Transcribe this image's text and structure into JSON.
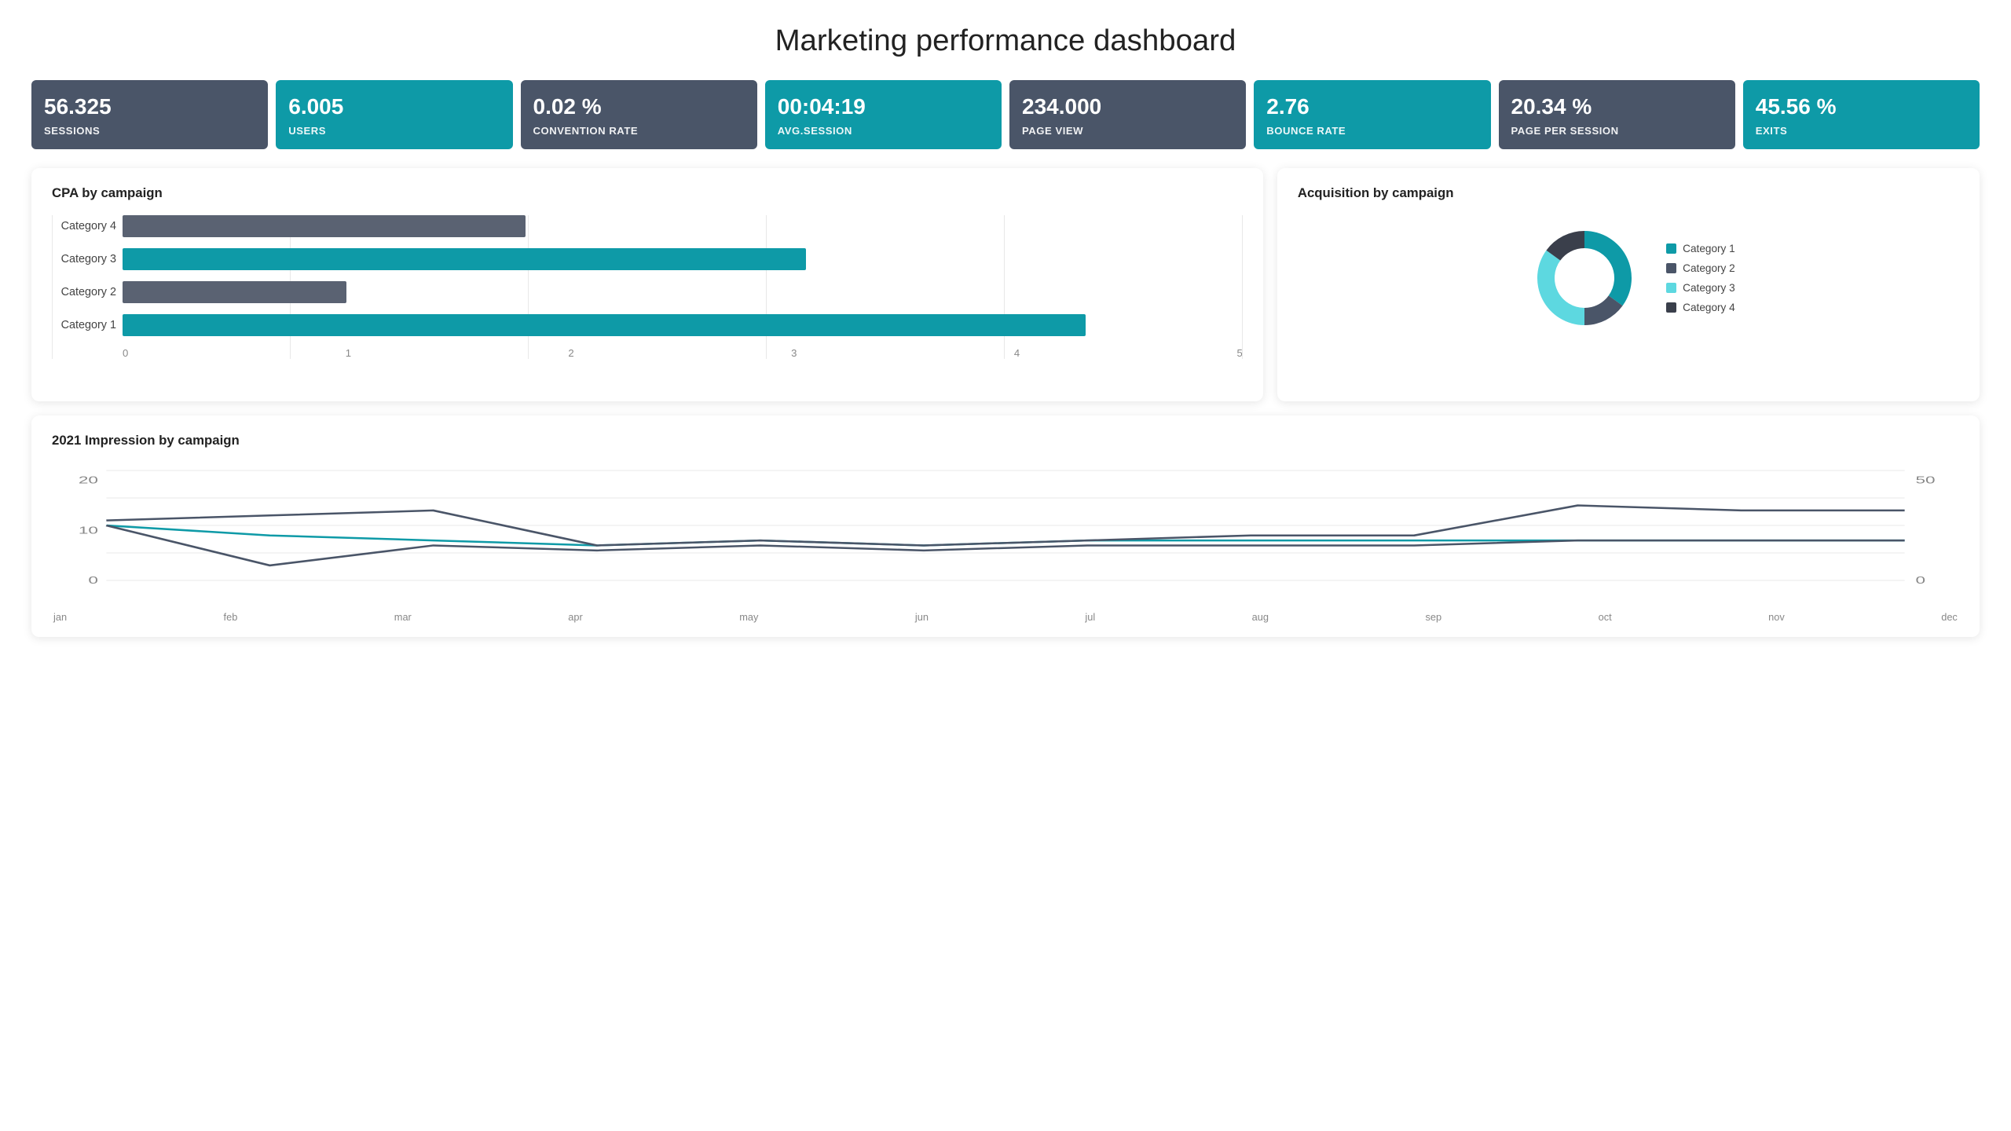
{
  "page": {
    "title": "Marketing performance dashboard"
  },
  "kpis": [
    {
      "id": "sessions",
      "value": "56.325",
      "label": "Sessions",
      "style": "dark"
    },
    {
      "id": "users",
      "value": "6.005",
      "label": "Users",
      "style": "teal"
    },
    {
      "id": "convention-rate",
      "value": "0.02 %",
      "label": "Convention Rate",
      "style": "dark"
    },
    {
      "id": "avg-session",
      "value": "00:04:19",
      "label": "Avg.Session",
      "style": "teal"
    },
    {
      "id": "page-view",
      "value": "234.000",
      "label": "Page View",
      "style": "dark"
    },
    {
      "id": "bounce-rate",
      "value": "2.76",
      "label": "Bounce Rate",
      "style": "teal"
    },
    {
      "id": "page-per-session",
      "value": "20.34 %",
      "label": "Page per Session",
      "style": "dark"
    },
    {
      "id": "exits",
      "value": "45.56 %",
      "label": "Exits",
      "style": "teal"
    }
  ],
  "cpa_chart": {
    "title": "CPA by campaign",
    "bars": [
      {
        "label": "Category 4",
        "value": 1.8,
        "color": "gray"
      },
      {
        "label": "Category 3",
        "value": 3.05,
        "color": "teal"
      },
      {
        "label": "Category 2",
        "value": 1.0,
        "color": "gray"
      },
      {
        "label": "Category 1",
        "value": 4.3,
        "color": "teal"
      }
    ],
    "x_ticks": [
      "0",
      "1",
      "2",
      "3",
      "4",
      "5"
    ],
    "max": 5
  },
  "acquisition_chart": {
    "title": "Acquisition by campaign",
    "segments": [
      {
        "label": "Category 1",
        "color": "#0e9aa7",
        "percent": 35
      },
      {
        "label": "Category 2",
        "color": "#4a5568",
        "percent": 15
      },
      {
        "label": "Category 3",
        "color": "#5dd8e0",
        "percent": 35
      },
      {
        "label": "Category 4",
        "color": "#3a3f4b",
        "percent": 15
      }
    ]
  },
  "impression_chart": {
    "title": "2021 Impression by campaign",
    "months": [
      "jan",
      "feb",
      "mar",
      "apr",
      "may",
      "jun",
      "jul",
      "aug",
      "sep",
      "oct",
      "nov",
      "dec"
    ],
    "y_left_ticks": [
      "0",
      "10",
      "20"
    ],
    "y_right_ticks": [
      "0",
      "50"
    ],
    "series": [
      {
        "name": "Category 1",
        "color": "#0e9aa7",
        "values": [
          11,
          9,
          8,
          7,
          8,
          7,
          8,
          8,
          8,
          8,
          8,
          8
        ]
      },
      {
        "name": "Category 2",
        "color": "#4a5568",
        "values": [
          12,
          13,
          14,
          7,
          8,
          7,
          8,
          9,
          9,
          15,
          14,
          14
        ]
      },
      {
        "name": "Category 3",
        "color": "#4a5568",
        "values": [
          11,
          3,
          7,
          6,
          7,
          6,
          7,
          7,
          7,
          8,
          8,
          8
        ]
      }
    ]
  }
}
